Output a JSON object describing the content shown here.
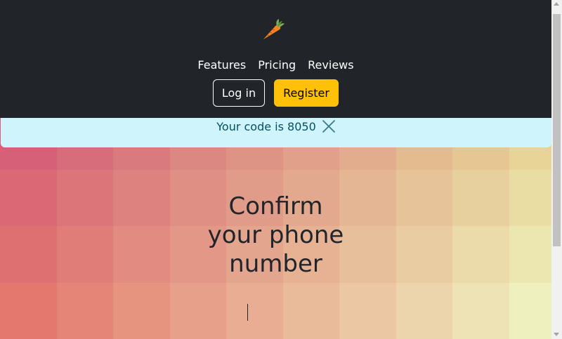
{
  "nav": {
    "logo_icon": "carrot-icon",
    "links": [
      {
        "label": "Features"
      },
      {
        "label": "Pricing"
      },
      {
        "label": "Reviews"
      }
    ],
    "login_label": "Log in",
    "register_label": "Register"
  },
  "alert": {
    "text": "Your code is 8050",
    "close_icon": "close-icon"
  },
  "main": {
    "heading_lines": [
      "Confirm",
      "your phone",
      "number"
    ],
    "code_value": "8050"
  },
  "colors": {
    "navbar_bg": "#212529",
    "register_accent": "#ffc107",
    "alert_bg": "#cff4fc",
    "alert_text": "#055160"
  }
}
